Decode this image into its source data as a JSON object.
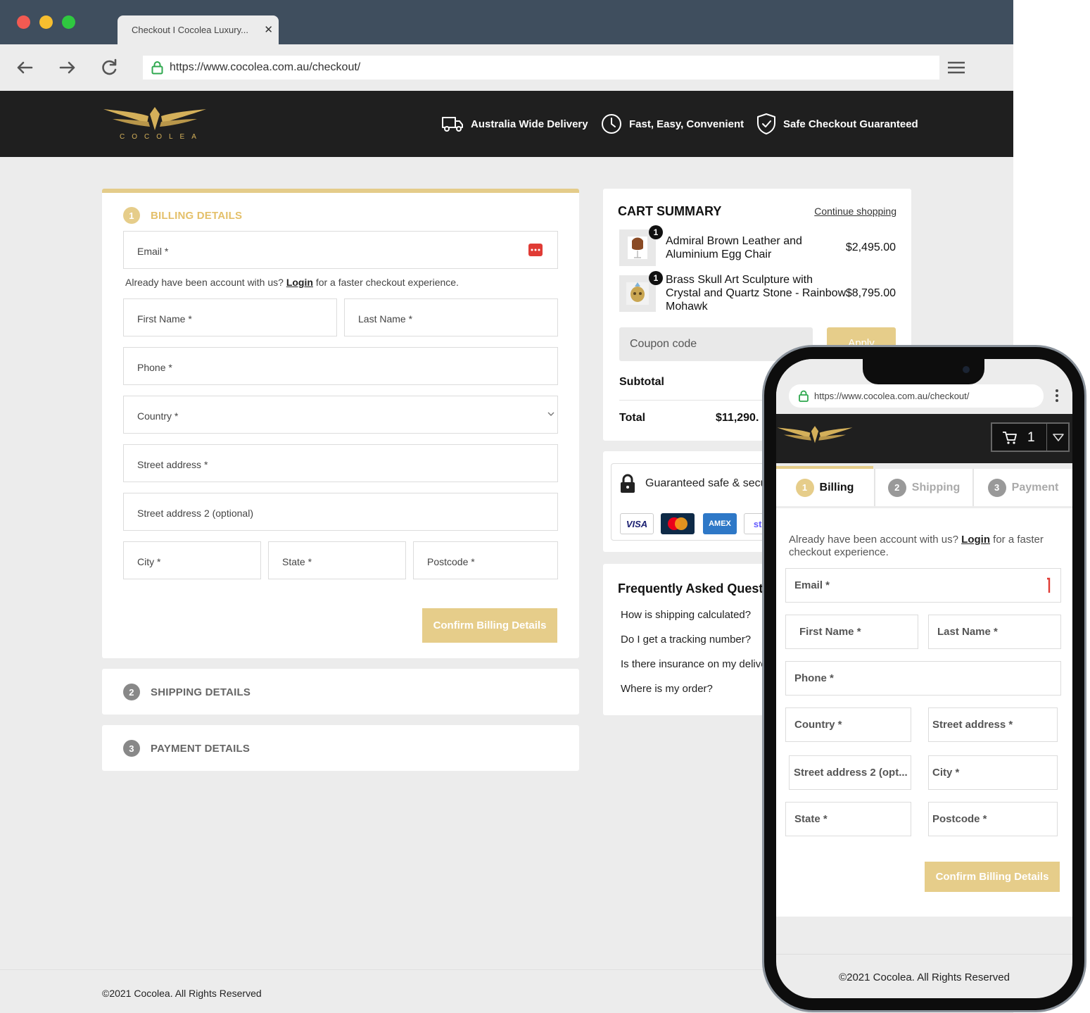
{
  "browser": {
    "tab_title": "Checkout I Cocolea Luxury...",
    "tab_close": "✕",
    "url": "https://www.cocolea.com.au/checkout/"
  },
  "header": {
    "logo_text": "COCOLEA",
    "features": [
      {
        "icon": "truck-icon",
        "label": "Australia Wide Delivery"
      },
      {
        "icon": "clock-icon",
        "label": "Fast, Easy, Convenient"
      },
      {
        "icon": "shield-check-icon",
        "label": "Safe Checkout Guaranteed"
      }
    ]
  },
  "billing": {
    "step": "1",
    "title": "BILLING DETAILS",
    "email_label": "Email *",
    "helper_pre": "Already have been account with us?",
    "helper_link": "Login",
    "helper_post": "for a faster checkout experience.",
    "first_name": "First Name *",
    "last_name": "Last Name *",
    "phone": "Phone *",
    "country": "Country *",
    "street": "Street address *",
    "street2": "Street address 2 (optional)",
    "city": "City *",
    "state": "State *",
    "postcode": "Postcode *",
    "confirm": "Confirm Billing Details"
  },
  "shipping": {
    "step": "2",
    "title": "SHIPPING DETAILS"
  },
  "payment": {
    "step": "3",
    "title": "PAYMENT DETAILS"
  },
  "cart": {
    "title": "CART SUMMARY",
    "continue": "Continue shopping",
    "items": [
      {
        "qty": "1",
        "name_line1": "Admiral Brown Leather and",
        "name_line2": "Aluminium Egg Chair",
        "name_line3": "",
        "price": "$2,495.00"
      },
      {
        "qty": "1",
        "name_line1": "Brass Skull Art Sculpture with",
        "name_line2": "Crystal and Quartz Stone - Rainbow",
        "name_line3": "Mohawk",
        "price": "$8,795.00"
      }
    ],
    "coupon_placeholder": "Coupon code",
    "apply": "Apply",
    "subtotal_label": "Subtotal",
    "total_label": "Total",
    "total_value": "$11,290."
  },
  "secure": {
    "text": "Guaranteed safe & secu",
    "cards": [
      "VISA",
      "AMEX",
      "stri"
    ]
  },
  "faq": {
    "title": "Frequently Asked Questic",
    "questions": [
      "How is shipping calculated?",
      "Do I get a tracking number?",
      "Is there insurance on my delive",
      "Where is my order?"
    ]
  },
  "footer": {
    "text": "©2021 Cocolea. All Rights Reserved"
  },
  "mobile": {
    "url": "https://www.cocolea.com.au/checkout/",
    "cart_count": "1",
    "tabs": [
      {
        "num": "1",
        "label": "Billing"
      },
      {
        "num": "2",
        "label": "Shipping"
      },
      {
        "num": "3",
        "label": "Payment"
      }
    ],
    "helper_pre": "Already have been account with us?",
    "helper_link": "Login",
    "helper_post": "for a faster checkout experience.",
    "email": "Email *",
    "first_name": "First Name *",
    "last_name": "Last Name *",
    "phone": "Phone *",
    "country": "Country *",
    "street": "Street address *",
    "street2": "Street address 2 (opt...",
    "city": "City *",
    "state": "State *",
    "postcode": "Postcode *",
    "confirm": "Confirm Billing Details",
    "footer": "©2021 Cocolea. All Rights Reserved"
  },
  "colors": {
    "gold": "#e6cd8a",
    "gold_text": "#e4c06a",
    "dark": "#1f1f1f",
    "step_grey": "#888888"
  }
}
